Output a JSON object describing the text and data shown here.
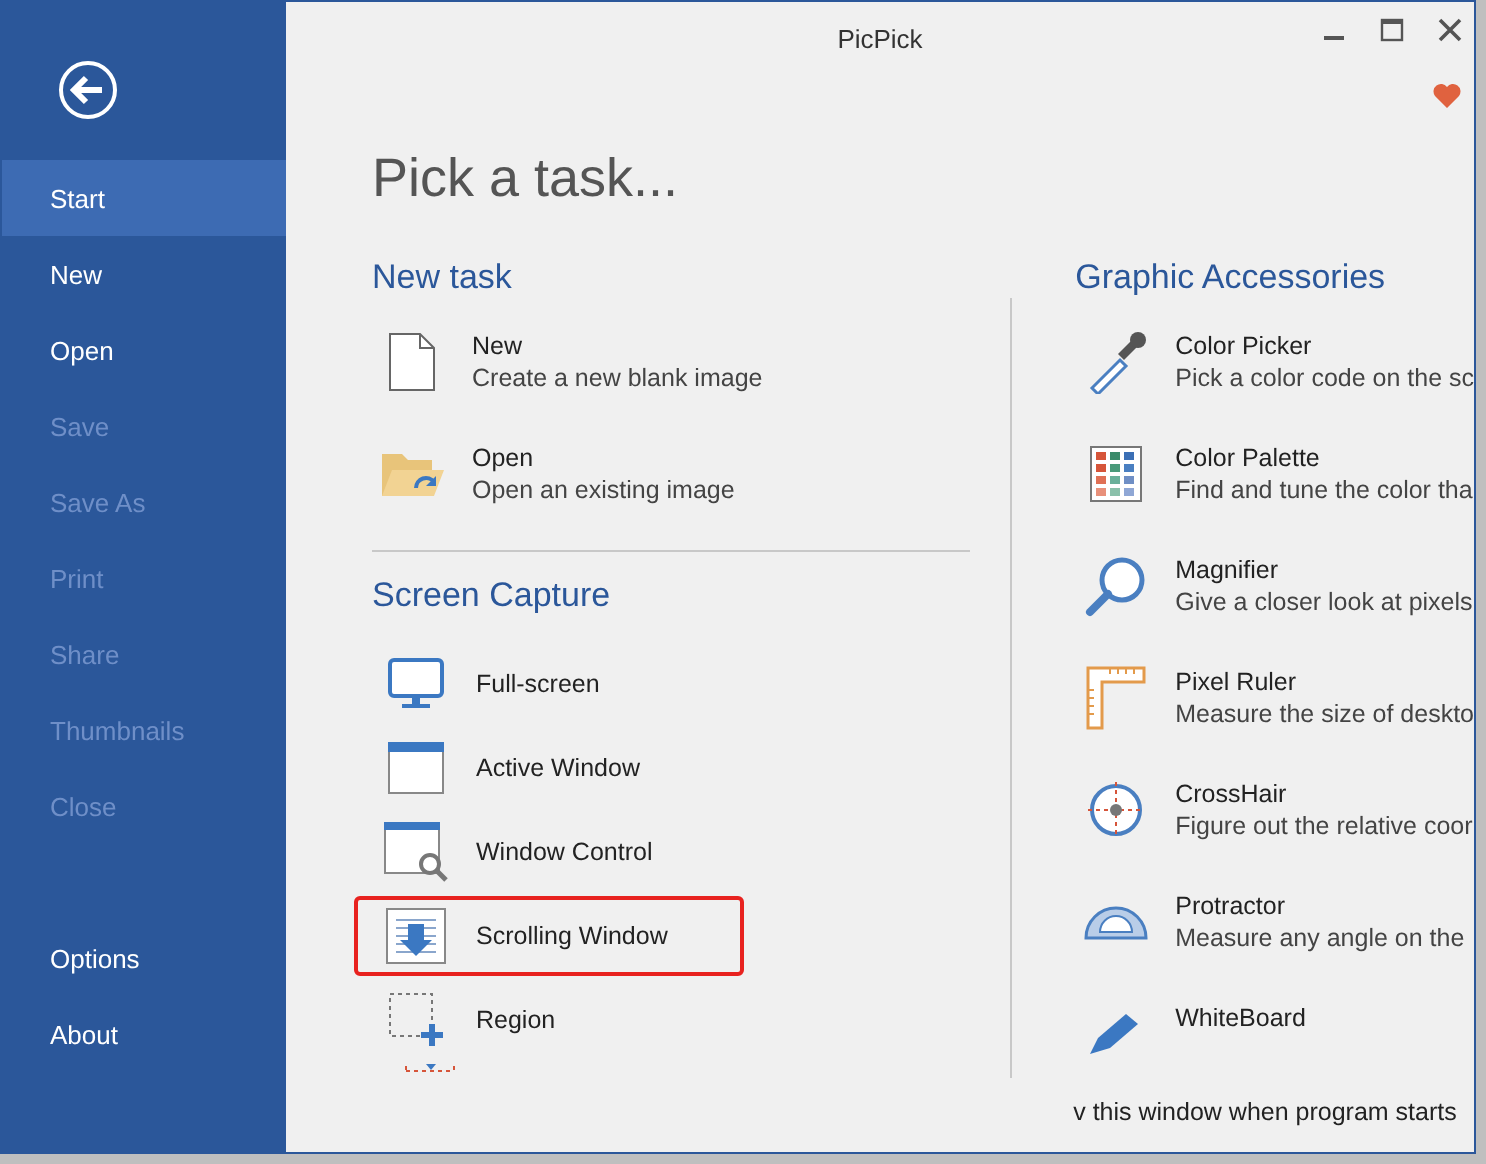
{
  "window": {
    "title": "PicPick"
  },
  "sidebar": {
    "items": [
      {
        "label": "Start",
        "selected": true,
        "disabled": false
      },
      {
        "label": "New",
        "selected": false,
        "disabled": false
      },
      {
        "label": "Open",
        "selected": false,
        "disabled": false
      },
      {
        "label": "Save",
        "selected": false,
        "disabled": true
      },
      {
        "label": "Save As",
        "selected": false,
        "disabled": true
      },
      {
        "label": "Print",
        "selected": false,
        "disabled": true
      },
      {
        "label": "Share",
        "selected": false,
        "disabled": true
      },
      {
        "label": "Thumbnails",
        "selected": false,
        "disabled": true
      },
      {
        "label": "Close",
        "selected": false,
        "disabled": true
      }
    ],
    "footer_items": [
      {
        "label": "Options",
        "selected": false,
        "disabled": false
      },
      {
        "label": "About",
        "selected": false,
        "disabled": false
      }
    ]
  },
  "heading": "Pick a task...",
  "new_task": {
    "title": "New task",
    "items": [
      {
        "label": "New",
        "description": "Create a new blank image"
      },
      {
        "label": "Open",
        "description": "Open an existing image"
      }
    ]
  },
  "screen_capture": {
    "title": "Screen Capture",
    "items": [
      {
        "label": "Full-screen",
        "highlighted": false
      },
      {
        "label": "Active Window",
        "highlighted": false
      },
      {
        "label": "Window Control",
        "highlighted": false
      },
      {
        "label": "Scrolling Window",
        "highlighted": true
      },
      {
        "label": "Region",
        "highlighted": false
      }
    ]
  },
  "graphic_accessories": {
    "title": "Graphic Accessories",
    "items": [
      {
        "label": "Color Picker",
        "description": "Pick a color code on the sc"
      },
      {
        "label": "Color Palette",
        "description": "Find and tune the color tha"
      },
      {
        "label": "Magnifier",
        "description": "Give a closer look at pixels"
      },
      {
        "label": "Pixel Ruler",
        "description": "Measure the size of deskto"
      },
      {
        "label": "CrossHair",
        "description": "Figure out the relative coor"
      },
      {
        "label": "Protractor",
        "description": "Measure any angle on the"
      },
      {
        "label": "WhiteBoard"
      }
    ]
  },
  "footer_text": "v this window when program starts"
}
